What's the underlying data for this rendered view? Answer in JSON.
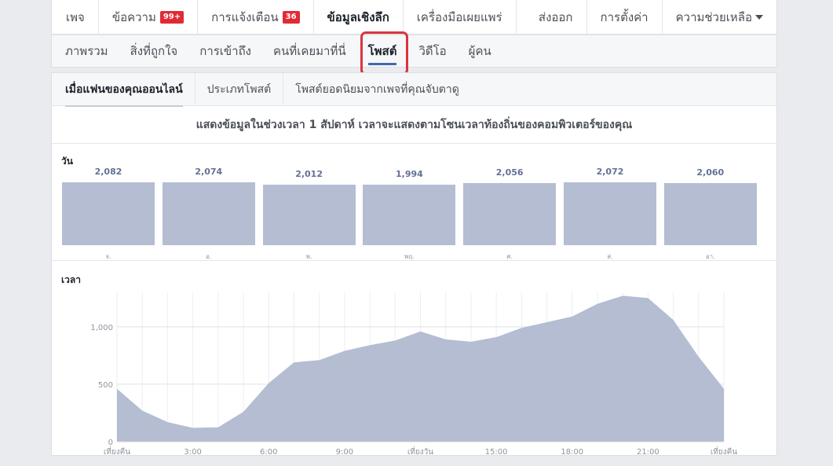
{
  "top_nav": {
    "items": [
      {
        "label": "เพจ"
      },
      {
        "label": "ข้อความ",
        "badge": "99+"
      },
      {
        "label": "การแจ้งเตือน",
        "badge": "36"
      },
      {
        "label": "ข้อมูลเชิงลึก"
      },
      {
        "label": "เครื่องมือเผยแพร่"
      }
    ],
    "right": [
      {
        "label": "ส่งออก"
      },
      {
        "label": "การตั้งค่า"
      },
      {
        "label": "ความช่วยเหลือ"
      }
    ]
  },
  "sub_nav": {
    "items": [
      {
        "label": "ภาพรวม"
      },
      {
        "label": "สิ่งที่ถูกใจ"
      },
      {
        "label": "การเข้าถึง"
      },
      {
        "label": "คนที่เคยมาที่นี่"
      },
      {
        "label": "โพสต์"
      },
      {
        "label": "วิดีโอ"
      },
      {
        "label": "ผู้คน"
      }
    ],
    "active_index": 4
  },
  "post_tabs": {
    "items": [
      {
        "label": "เมื่อแฟนของคุณออนไลน์"
      },
      {
        "label": "ประเภทโพสต์"
      },
      {
        "label": "โพสต์ยอดนิยมจากเพจที่คุณจับตาดู"
      }
    ]
  },
  "range_note": "แสดงข้อมูลในช่วงเวลา 1 สัปดาห์ เวลาจะแสดงตามโซนเวลาท้องถิ่นของคอมพิวเตอร์ของคุณ",
  "colors": {
    "accent": "#4267b2",
    "bar": "#b4bdd2",
    "value_text": "#637196",
    "highlight": "#d9363e",
    "badge": "#e02b36"
  },
  "chart_data": [
    {
      "type": "bar",
      "title": "วัน",
      "categories": [
        "จ.",
        "อ.",
        "พ.",
        "พฤ.",
        "ศ.",
        "ส.",
        "อา."
      ],
      "values": [
        2082,
        2074,
        2012,
        1994,
        2056,
        2072,
        2060
      ],
      "value_labels": [
        "2,082",
        "2,074",
        "2,012",
        "1,994",
        "2,056",
        "2,072",
        "2,060"
      ]
    },
    {
      "type": "area",
      "title": "เวลา",
      "x": [
        0,
        1,
        2,
        3,
        4,
        5,
        6,
        7,
        8,
        9,
        10,
        11,
        12,
        13,
        14,
        15,
        16,
        17,
        18,
        19,
        20,
        21,
        22,
        23,
        24
      ],
      "y": [
        460,
        270,
        170,
        120,
        125,
        260,
        510,
        690,
        710,
        790,
        840,
        880,
        960,
        890,
        870,
        910,
        990,
        1040,
        1090,
        1200,
        1270,
        1250,
        1060,
        740,
        460
      ],
      "ylim": [
        0,
        1300
      ],
      "yticks": [
        0,
        500,
        1000
      ],
      "ytick_labels": [
        "0",
        "500",
        "1,000"
      ],
      "xticks": [
        0,
        3,
        6,
        9,
        12,
        15,
        18,
        21,
        24
      ],
      "xtick_labels": [
        "เที่ยงคืน",
        "3:00",
        "6:00",
        "9:00",
        "เที่ยงวัน",
        "15:00",
        "18:00",
        "21:00",
        "เที่ยงคืน"
      ],
      "grid": true
    }
  ]
}
